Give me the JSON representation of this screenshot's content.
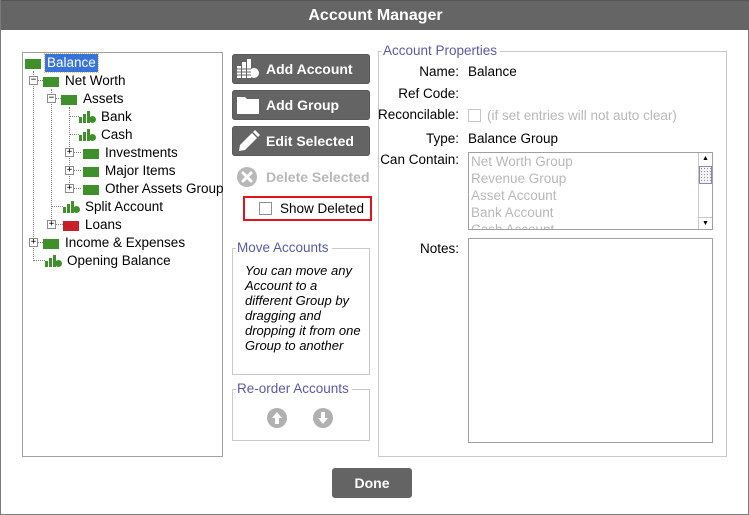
{
  "window": {
    "title": "Account Manager"
  },
  "tree": {
    "items": [
      {
        "label": "Balance",
        "type": "group",
        "color": "#3f8f2a",
        "selected": true,
        "depth": 0
      },
      {
        "label": "Net Worth",
        "type": "group",
        "color": "#3f8f2a",
        "expanded": true,
        "depth": 1
      },
      {
        "label": "Assets",
        "type": "group",
        "color": "#3f8f2a",
        "expanded": true,
        "depth": 2
      },
      {
        "label": "Bank",
        "type": "account",
        "depth": 3
      },
      {
        "label": "Cash",
        "type": "account",
        "depth": 3
      },
      {
        "label": "Investments",
        "type": "group",
        "color": "#3f8f2a",
        "expanded": false,
        "depth": 3
      },
      {
        "label": "Major Items",
        "type": "group",
        "color": "#3f8f2a",
        "expanded": false,
        "depth": 3
      },
      {
        "label": "Other Assets Group",
        "type": "group",
        "color": "#3f8f2a",
        "expanded": false,
        "depth": 3
      },
      {
        "label": "Split Account",
        "type": "account",
        "depth": 2
      },
      {
        "label": "Loans",
        "type": "group",
        "color": "#c8202a",
        "expanded": false,
        "depth": 2
      },
      {
        "label": "Income & Expenses",
        "type": "group",
        "color": "#3f8f2a",
        "expanded": false,
        "depth": 1
      },
      {
        "label": "Opening Balance",
        "type": "account",
        "depth": 1
      }
    ]
  },
  "actions": {
    "add_account": "Add Account",
    "add_group": "Add Group",
    "edit_selected": "Edit Selected",
    "delete_selected": "Delete Selected",
    "show_deleted": "Show Deleted",
    "show_deleted_checked": false
  },
  "move_accounts": {
    "legend": "Move Accounts",
    "text": "You can move any Account to a different Group by dragging and dropping it from one Group to another"
  },
  "reorder_accounts": {
    "legend": "Re-order Accounts",
    "up_icon": "arrow-up-circle",
    "down_icon": "arrow-down-circle"
  },
  "properties": {
    "legend": "Account Properties",
    "name_label": "Name:",
    "name_value": "Balance",
    "ref_code_label": "Ref Code:",
    "ref_code_value": "",
    "reconcilable_label": "Reconcilable:",
    "reconcilable_hint": "(if set entries will not auto clear)",
    "reconcilable_checked": false,
    "type_label": "Type:",
    "type_value": "Balance Group",
    "can_contain_label": "Can Contain:",
    "can_contain_items": [
      "Net Worth Group",
      "Revenue Group",
      "Asset Account",
      "Bank Account",
      "Cash Account"
    ],
    "notes_label": "Notes:",
    "notes_value": ""
  },
  "footer": {
    "done": "Done"
  },
  "colors": {
    "titlebar": "#656565",
    "button": "#646464",
    "selection": "#3874d8",
    "legend": "#5a5aa8",
    "highlight_border": "#e0141e"
  }
}
